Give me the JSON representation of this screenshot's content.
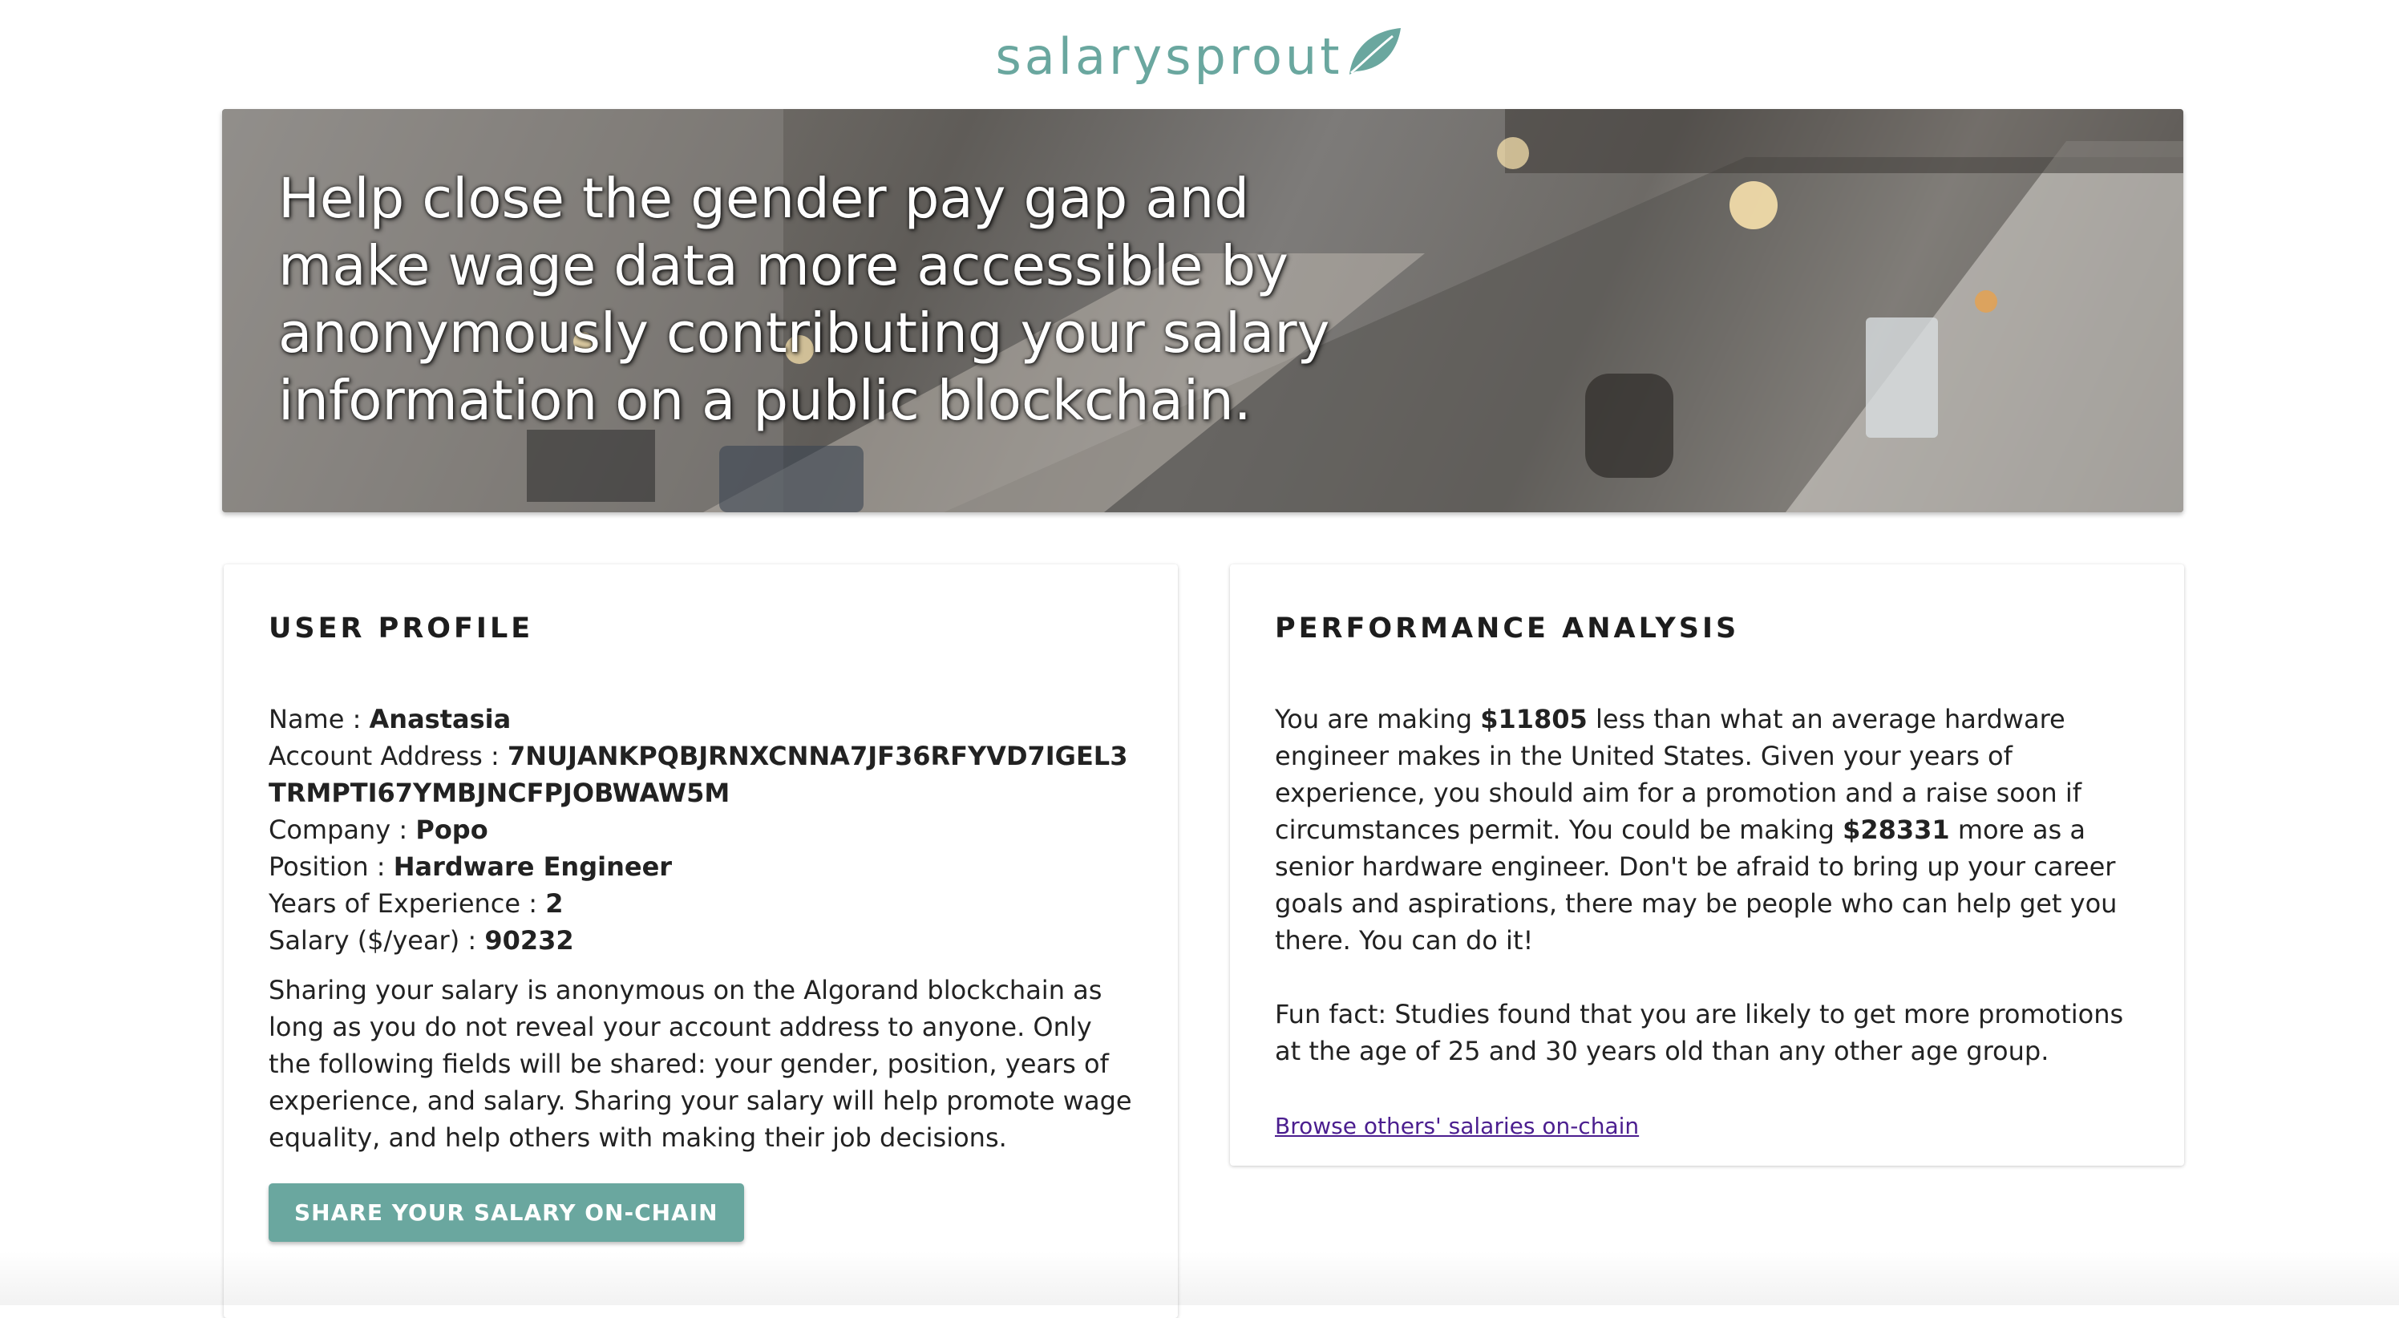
{
  "brand": {
    "name": "salarysprout",
    "accent_color": "#6aa79f",
    "icon": "leaf-icon"
  },
  "hero": {
    "headline": "Help close the gender pay gap and make wage data more accessible by anonymously contributing your salary information on a public blockchain."
  },
  "profile": {
    "title": "USER PROFILE",
    "name_label": "Name : ",
    "name_value": "Anastasia",
    "address_label": "Account Address : ",
    "address_value": "7NUJANKPQBJRNXCNNA7JF36RFYVD7IGEL3TRMPTI67YMBJNCFPJOBWAW5M",
    "company_label": "Company : ",
    "company_value": "Popo",
    "position_label": "Position : ",
    "position_value": "Hardware Engineer",
    "experience_label": "Years of Experience : ",
    "experience_value": "2",
    "salary_label": "Salary ($/year) : ",
    "salary_value": "90232",
    "disclaimer": "Sharing your salary is anonymous on the Algorand blockchain as long as you do not reveal your account address to anyone. Only the following fields will be shared: your gender, position, years of experience, and salary. Sharing your salary will help promote wage equality, and help others with making their job decisions.",
    "share_button": "SHARE YOUR SALARY ON-CHAIN"
  },
  "performance": {
    "title": "PERFORMANCE ANALYSIS",
    "analysis_part1": "You are making ",
    "analysis_amount1": "$11805",
    "analysis_part2": " less than what an average hardware engineer makes in the United States. Given your years of experience, you should aim for a promotion and a raise soon if circumstances permit. You could be making ",
    "analysis_amount2": "$28331",
    "analysis_part3": " more as a senior hardware engineer. Don't be afraid to bring up your career goals and aspirations, there may be people who can help get you there. You can do it!",
    "fun_fact": "Fun fact: Studies found that you are likely to get more promotions at the age of 25 and 30 years old than any other age group.",
    "browse_link": "Browse others' salaries on-chain"
  }
}
